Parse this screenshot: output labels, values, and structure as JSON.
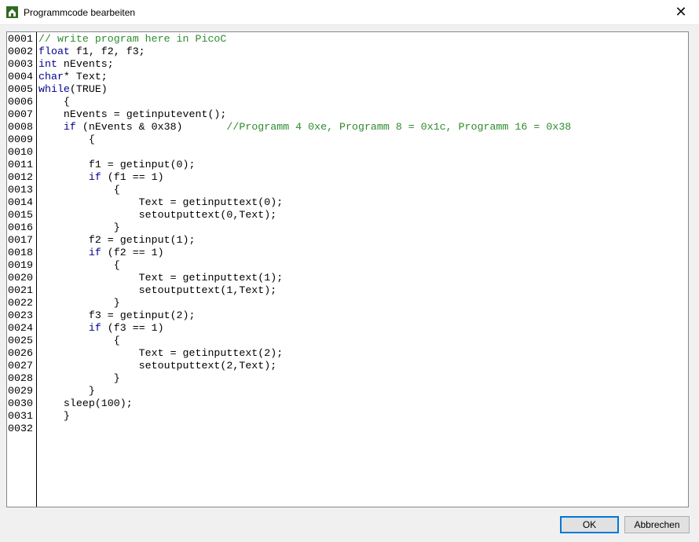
{
  "window": {
    "title": "Programmcode bearbeiten",
    "close_label": "✕"
  },
  "editor": {
    "lines": [
      {
        "n": "0001",
        "segs": [
          [
            "// write program here in PicoC",
            "cm"
          ]
        ]
      },
      {
        "n": "0002",
        "segs": [
          [
            "float",
            "kw"
          ],
          [
            " f1, f2, f3;",
            ""
          ]
        ]
      },
      {
        "n": "0003",
        "segs": [
          [
            "int",
            "kw"
          ],
          [
            " nEvents;",
            ""
          ]
        ]
      },
      {
        "n": "0004",
        "segs": [
          [
            "char",
            "kw"
          ],
          [
            "* Text;",
            ""
          ]
        ]
      },
      {
        "n": "0005",
        "segs": [
          [
            "while",
            "kw"
          ],
          [
            "(TRUE)",
            ""
          ]
        ]
      },
      {
        "n": "0006",
        "segs": [
          [
            "    {",
            ""
          ]
        ]
      },
      {
        "n": "0007",
        "segs": [
          [
            "    nEvents = getinputevent();",
            ""
          ]
        ]
      },
      {
        "n": "0008",
        "segs": [
          [
            "    ",
            ""
          ],
          [
            "if",
            "kw"
          ],
          [
            " (nEvents & 0x38)       ",
            ""
          ],
          [
            "//Programm 4 0xe, Programm 8 = 0x1c, Programm 16 = 0x38",
            "cm"
          ]
        ]
      },
      {
        "n": "0009",
        "segs": [
          [
            "        {",
            ""
          ]
        ]
      },
      {
        "n": "0010",
        "segs": []
      },
      {
        "n": "0011",
        "segs": [
          [
            "        f1 = getinput(0);",
            ""
          ]
        ]
      },
      {
        "n": "0012",
        "segs": [
          [
            "        ",
            ""
          ],
          [
            "if",
            "kw"
          ],
          [
            " (f1 == 1)",
            ""
          ]
        ]
      },
      {
        "n": "0013",
        "segs": [
          [
            "            {",
            ""
          ]
        ]
      },
      {
        "n": "0014",
        "segs": [
          [
            "                Text = getinputtext(0);",
            ""
          ]
        ]
      },
      {
        "n": "0015",
        "segs": [
          [
            "                setoutputtext(0,Text);",
            ""
          ]
        ]
      },
      {
        "n": "0016",
        "segs": [
          [
            "            }",
            ""
          ]
        ]
      },
      {
        "n": "0017",
        "segs": [
          [
            "        f2 = getinput(1);",
            ""
          ]
        ]
      },
      {
        "n": "0018",
        "segs": [
          [
            "        ",
            ""
          ],
          [
            "if",
            "kw"
          ],
          [
            " (f2 == 1)",
            ""
          ]
        ]
      },
      {
        "n": "0019",
        "segs": [
          [
            "            {",
            ""
          ]
        ]
      },
      {
        "n": "0020",
        "segs": [
          [
            "                Text = getinputtext(1);",
            ""
          ]
        ]
      },
      {
        "n": "0021",
        "segs": [
          [
            "                setoutputtext(1,Text);",
            ""
          ]
        ]
      },
      {
        "n": "0022",
        "segs": [
          [
            "            }",
            ""
          ]
        ]
      },
      {
        "n": "0023",
        "segs": [
          [
            "        f3 = getinput(2);",
            ""
          ]
        ]
      },
      {
        "n": "0024",
        "segs": [
          [
            "        ",
            ""
          ],
          [
            "if",
            "kw"
          ],
          [
            " (f3 == 1)",
            ""
          ]
        ]
      },
      {
        "n": "0025",
        "segs": [
          [
            "            {",
            ""
          ]
        ]
      },
      {
        "n": "0026",
        "segs": [
          [
            "                Text = getinputtext(2);",
            ""
          ]
        ]
      },
      {
        "n": "0027",
        "segs": [
          [
            "                setoutputtext(2,Text);",
            ""
          ]
        ]
      },
      {
        "n": "0028",
        "segs": [
          [
            "            }",
            ""
          ]
        ]
      },
      {
        "n": "0029",
        "segs": [
          [
            "        }",
            ""
          ]
        ]
      },
      {
        "n": "0030",
        "segs": [
          [
            "    sleep(100);",
            ""
          ]
        ]
      },
      {
        "n": "0031",
        "segs": [
          [
            "    }",
            ""
          ]
        ]
      },
      {
        "n": "0032",
        "segs": []
      }
    ]
  },
  "buttons": {
    "ok": "OK",
    "cancel": "Abbrechen"
  },
  "colors": {
    "keyword": "#00008b",
    "comment": "#2e8b2e",
    "focus": "#0078d7"
  }
}
